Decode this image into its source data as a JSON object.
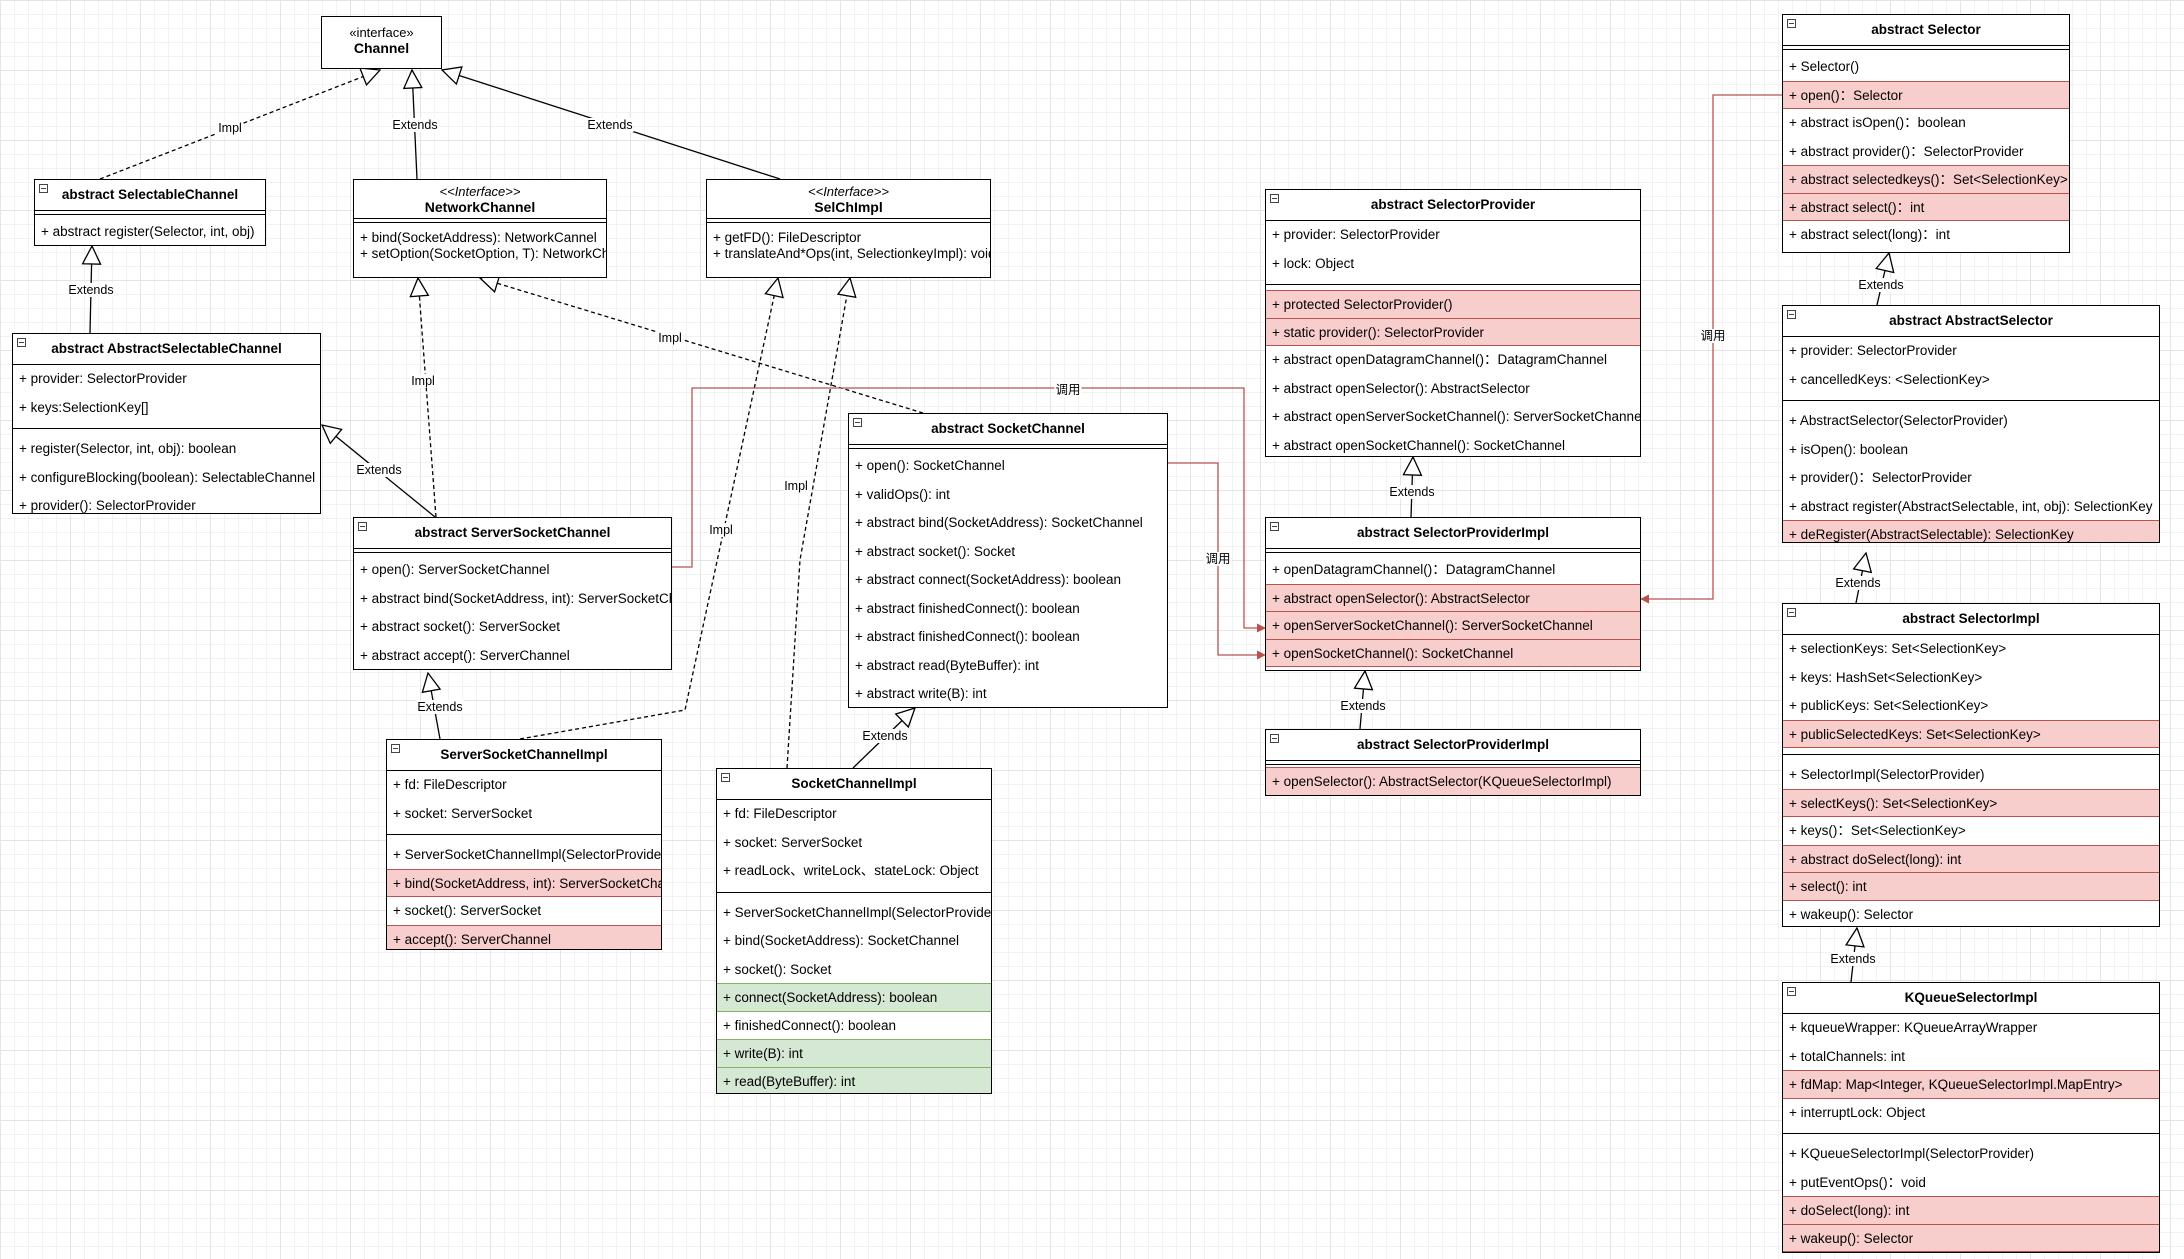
{
  "classes": {
    "channel": {
      "stereotype": "«interface»",
      "name": "Channel"
    },
    "selectable_channel": {
      "name": "abstract SelectableChannel",
      "methods": [
        {
          "text": "+ abstract register(Selector, int, obj)",
          "hl": ""
        }
      ]
    },
    "network_channel": {
      "stereotype": "<<Interface>>",
      "name": "NetworkChannel",
      "lines": [
        "+ bind(SocketAddress): NetworkCannel",
        "+ setOption(SocketOption, T): NetworkChannel"
      ]
    },
    "selchimpl": {
      "stereotype": "<<Interface>>",
      "name": "SelChImpl",
      "lines": [
        "+ getFD(): FileDescriptor",
        "+ translateAnd*Ops(int, SelectionkeyImpl): void"
      ]
    },
    "abstract_selectable_channel": {
      "name": "abstract AbstractSelectableChannel",
      "fields": [
        {
          "text": "+ provider: SelectorProvider",
          "hl": ""
        },
        {
          "text": "+ keys:SelectionKey[]",
          "hl": ""
        }
      ],
      "methods": [
        {
          "text": "+ register(Selector, int, obj): boolean",
          "hl": ""
        },
        {
          "text": "+ configureBlocking(boolean): SelectableChannel",
          "hl": ""
        },
        {
          "text": "+ provider(): SelectorProvider",
          "hl": ""
        }
      ]
    },
    "server_socket_channel": {
      "name": "abstract ServerSocketChannel",
      "methods": [
        {
          "text": "+ open(): ServerSocketChannel",
          "hl": ""
        },
        {
          "text": "+ abstract bind(SocketAddress, int): ServerSocketChannel",
          "hl": ""
        },
        {
          "text": "+ abstract socket(): ServerSocket",
          "hl": ""
        },
        {
          "text": "+ abstract accept(): ServerChannel",
          "hl": ""
        }
      ]
    },
    "socket_channel": {
      "name": "abstract SocketChannel",
      "methods": [
        {
          "text": "+ open(): SocketChannel",
          "hl": ""
        },
        {
          "text": "+ validOps(): int",
          "hl": ""
        },
        {
          "text": "+ abstract bind(SocketAddress): SocketChannel",
          "hl": ""
        },
        {
          "text": "+ abstract socket(): Socket",
          "hl": ""
        },
        {
          "text": "+ abstract connect(SocketAddress): boolean",
          "hl": ""
        },
        {
          "text": "+ abstract finishedConnect(): boolean",
          "hl": ""
        },
        {
          "text": "+ abstract finishedConnect(): boolean",
          "hl": ""
        },
        {
          "text": "+ abstract read(ByteBuffer): int",
          "hl": ""
        },
        {
          "text": "+ abstract write(B): int",
          "hl": ""
        }
      ]
    },
    "server_socket_channel_impl": {
      "name": "ServerSocketChannelImpl",
      "fields": [
        {
          "text": "+ fd: FileDescriptor",
          "hl": ""
        },
        {
          "text": "+ socket: ServerSocket",
          "hl": ""
        }
      ],
      "methods": [
        {
          "text": "+ ServerSocketChannelImpl(SelectorProvider)",
          "hl": ""
        },
        {
          "text": "+ bind(SocketAddress, int): ServerSocketChannel",
          "hl": "red"
        },
        {
          "text": "+ socket(): ServerSocket",
          "hl": ""
        },
        {
          "text": "+ accept(): ServerChannel",
          "hl": "red"
        }
      ]
    },
    "socket_channel_impl": {
      "name": "SocketChannelImpl",
      "fields": [
        {
          "text": "+ fd: FileDescriptor",
          "hl": ""
        },
        {
          "text": "+ socket: ServerSocket",
          "hl": ""
        },
        {
          "text": "+ readLock、writeLock、stateLock: Object",
          "hl": ""
        }
      ],
      "methods": [
        {
          "text": "+ ServerSocketChannelImpl(SelectorProvider)",
          "hl": ""
        },
        {
          "text": "+ bind(SocketAddress): SocketChannel",
          "hl": ""
        },
        {
          "text": "+ socket(): Socket",
          "hl": ""
        },
        {
          "text": "+ connect(SocketAddress): boolean",
          "hl": "green"
        },
        {
          "text": "+ finishedConnect(): boolean",
          "hl": ""
        },
        {
          "text": "+ write(B): int",
          "hl": "green"
        },
        {
          "text": "+ read(ByteBuffer): int",
          "hl": "green"
        }
      ]
    },
    "selector_provider": {
      "name": "abstract SelectorProvider",
      "fields": [
        {
          "text": "+ provider: SelectorProvider",
          "hl": ""
        },
        {
          "text": "+ lock: Object",
          "hl": ""
        }
      ],
      "methods": [
        {
          "text": "+ protected SelectorProvider()",
          "hl": "red"
        },
        {
          "text": "+ static provider(): SelectorProvider",
          "hl": "red"
        },
        {
          "text": "+ abstract openDatagramChannel()：DatagramChannel",
          "hl": ""
        },
        {
          "text": "+ abstract openSelector(): AbstractSelector",
          "hl": ""
        },
        {
          "text": "+ abstract openServerSocketChannel(): ServerSocketChannel",
          "hl": ""
        },
        {
          "text": "+ abstract openSocketChannel(): SocketChannel",
          "hl": ""
        }
      ]
    },
    "selector_provider_impl": {
      "name": "abstract SelectorProviderImpl",
      "methods": [
        {
          "text": "+ openDatagramChannel()：DatagramChannel",
          "hl": ""
        },
        {
          "text": "+ abstract openSelector(): AbstractSelector",
          "hl": "red"
        },
        {
          "text": "+ openServerSocketChannel(): ServerSocketChannel",
          "hl": "red"
        },
        {
          "text": "+ openSocketChannel(): SocketChannel",
          "hl": "red"
        }
      ]
    },
    "selector_provider_impl_2": {
      "name": "abstract SelectorProviderImpl",
      "methods": [
        {
          "text": "+ openSelector(): AbstractSelector(KQueueSelectorImpl)",
          "hl": "red"
        }
      ]
    },
    "selector": {
      "name": "abstract Selector",
      "methods": [
        {
          "text": "+ Selector()",
          "hl": ""
        },
        {
          "text": "+ open()：Selector",
          "hl": "red"
        },
        {
          "text": "+ abstract isOpen()：boolean",
          "hl": ""
        },
        {
          "text": "+ abstract provider()：SelectorProvider",
          "hl": ""
        },
        {
          "text": "+ abstract selectedkeys()：Set<SelectionKey>",
          "hl": "red"
        },
        {
          "text": "+ abstract select()：int",
          "hl": "red"
        },
        {
          "text": "+ abstract select(long)：int",
          "hl": ""
        }
      ]
    },
    "abstract_selector": {
      "name": "abstract AbstractSelector",
      "fields": [
        {
          "text": "+ provider: SelectorProvider",
          "hl": ""
        },
        {
          "text": "+ cancelledKeys: <SelectionKey>",
          "hl": ""
        }
      ],
      "methods": [
        {
          "text": "+ AbstractSelector(SelectorProvider)",
          "hl": ""
        },
        {
          "text": "+ isOpen(): boolean",
          "hl": ""
        },
        {
          "text": "+ provider()：SelectorProvider",
          "hl": ""
        },
        {
          "text": "+ abstract register(AbstractSelectable, int, obj): SelectionKey",
          "hl": ""
        },
        {
          "text": "+ deRegister(AbstractSelectable): SelectionKey",
          "hl": "red"
        }
      ]
    },
    "selector_impl": {
      "name": "abstract SelectorImpl",
      "fields": [
        {
          "text": "+ selectionKeys: Set<SelectionKey>",
          "hl": ""
        },
        {
          "text": "+ keys: HashSet<SelectionKey>",
          "hl": ""
        },
        {
          "text": "+ publicKeys: Set<SelectionKey>",
          "hl": ""
        },
        {
          "text": "+ publicSelectedKeys: Set<SelectionKey>",
          "hl": "red"
        }
      ],
      "methods": [
        {
          "text": "+ SelectorImpl(SelectorProvider)",
          "hl": ""
        },
        {
          "text": "+ selectKeys(): Set<SelectionKey>",
          "hl": "red"
        },
        {
          "text": "+ keys()：Set<SelectionKey>",
          "hl": ""
        },
        {
          "text": "+ abstract doSelect(long): int",
          "hl": "red"
        },
        {
          "text": "+ select(): int",
          "hl": "red"
        },
        {
          "text": "+ wakeup(): Selector",
          "hl": ""
        }
      ]
    },
    "kqueue_selector_impl": {
      "name": "KQueueSelectorImpl",
      "fields": [
        {
          "text": "+ kqueueWrapper: KQueueArrayWrapper",
          "hl": ""
        },
        {
          "text": "+ totalChannels: int",
          "hl": ""
        },
        {
          "text": "+ fdMap: Map<Integer, KQueueSelectorImpl.MapEntry>",
          "hl": "red"
        },
        {
          "text": "+ interruptLock: Object",
          "hl": ""
        }
      ],
      "methods": [
        {
          "text": "+ KQueueSelectorImpl(SelectorProvider)",
          "hl": ""
        },
        {
          "text": "+ putEventOps()：void",
          "hl": ""
        },
        {
          "text": "+ doSelect(long): int",
          "hl": "red"
        },
        {
          "text": "+ wakeup(): Selector",
          "hl": "red"
        }
      ]
    }
  },
  "edges": [
    {
      "id": "impl-selectable-channel",
      "kind": "realization",
      "label": "Impl"
    },
    {
      "id": "extends-network-channel",
      "kind": "generalization",
      "label": "Extends"
    },
    {
      "id": "extends-selchimpl",
      "kind": "generalization",
      "label": "Extends"
    },
    {
      "id": "extends-abstract-selectable",
      "kind": "generalization",
      "label": "Extends"
    },
    {
      "id": "impl-ssc-networkchannel",
      "kind": "realization",
      "label": "Impl"
    },
    {
      "id": "impl-sc-networkchannel",
      "kind": "realization",
      "label": "Impl"
    },
    {
      "id": "extends-ssc",
      "kind": "generalization",
      "label": "Extends"
    },
    {
      "id": "extends-ssc-impl",
      "kind": "generalization",
      "label": "Extends"
    },
    {
      "id": "impl-ssci-selchimpl",
      "kind": "realization",
      "label": "Impl"
    },
    {
      "id": "impl-sci-selchimpl",
      "kind": "realization",
      "label": "Impl"
    },
    {
      "id": "extends-sc-impl",
      "kind": "generalization",
      "label": "Extends"
    },
    {
      "id": "call-ssc-open",
      "kind": "call",
      "label": "调用"
    },
    {
      "id": "call-sc-open",
      "kind": "call",
      "label": "调用"
    },
    {
      "id": "call-selector-open",
      "kind": "call",
      "label": "调用"
    },
    {
      "id": "extends-spi",
      "kind": "generalization",
      "label": "Extends"
    },
    {
      "id": "extends-spi2",
      "kind": "generalization",
      "label": "Extends"
    },
    {
      "id": "extends-abstract-selector",
      "kind": "generalization",
      "label": "Extends"
    },
    {
      "id": "extends-selector-impl",
      "kind": "generalization",
      "label": "Extends"
    },
    {
      "id": "extends-kqueue",
      "kind": "generalization",
      "label": "Extends"
    }
  ],
  "colors": {
    "highlight_red_fill": "#f8cecc",
    "highlight_red_stroke": "#b85450",
    "highlight_green_fill": "#d5e8d4",
    "highlight_green_stroke": "#82b366",
    "call_edge": "#b85450"
  }
}
